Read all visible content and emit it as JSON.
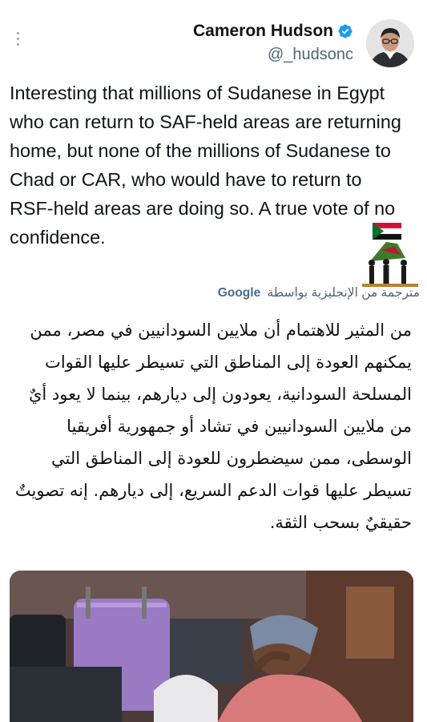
{
  "author": {
    "display_name": "Cameron Hudson",
    "handle": "@_hudsonc"
  },
  "tweet": {
    "text": "Interesting that millions of Sudanese in Egypt who can return to SAF-held areas are returning home, but none of the millions of Sudanese to Chad or CAR, who would have to return to RSF-held areas are doing so. A true vote of no confidence."
  },
  "translation": {
    "label": "مترجمة من الإنجليزية بواسطة",
    "provider": "Google",
    "text": "من المثير للاهتمام أن ملايين السودانيين في مصر، ممن يمكنهم العودة إلى المناطق التي تسيطر عليها القوات المسلحة السودانية، يعودون إلى ديارهم، بينما لا يعود أيٌ من ملايين السودانيين في تشاد أو جمهورية أفريقيا الوسطى، ممن سيضطرون للعودة إلى المناطق التي تسيطر عليها قوات الدعم السريع، إلى ديارهم. إنه تصويتٌ حقيقيٌ بسحب الثقة."
  },
  "icons": {
    "more": "more-vertical-icon",
    "verified": "verified-badge-icon"
  },
  "colors": {
    "verified_blue": "#1d9bf0",
    "text_primary": "#0f1419",
    "text_secondary": "#536471"
  }
}
